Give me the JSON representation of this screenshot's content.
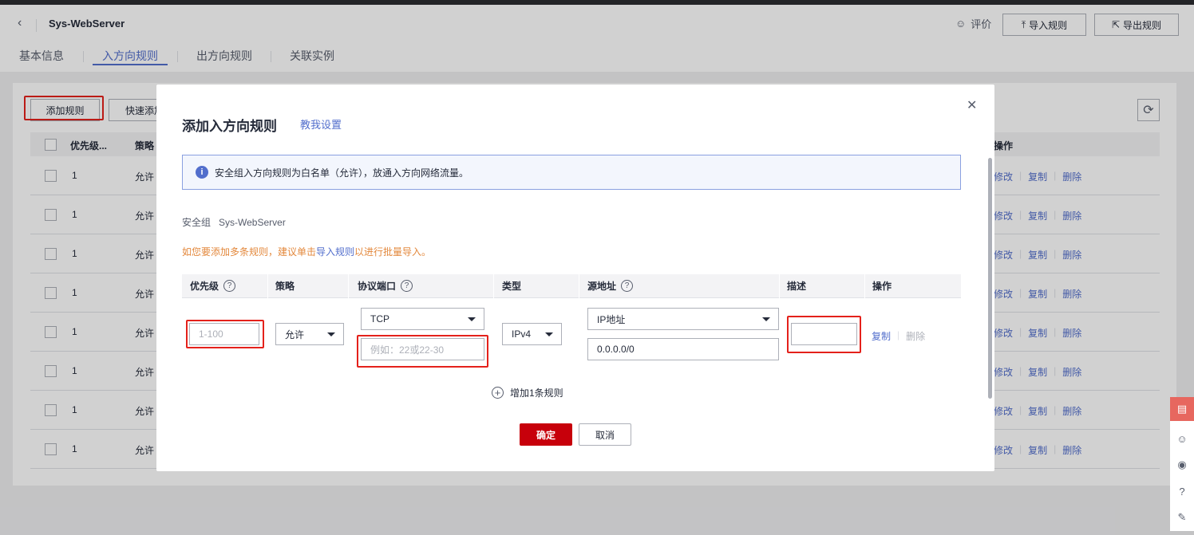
{
  "header": {
    "title": "Sys-WebServer",
    "rate_label": "评价",
    "import_label": "导入规则",
    "export_label": "导出规则"
  },
  "tabs": [
    {
      "label": "基本信息"
    },
    {
      "label": "入方向规则"
    },
    {
      "label": "出方向规则"
    },
    {
      "label": "关联实例"
    }
  ],
  "toolbar": {
    "add_rule": "添加规则",
    "quick_add": "快速添加"
  },
  "table": {
    "headers": {
      "priority": "优先级...",
      "strategy": "策略",
      "ops": "操作"
    },
    "rows": [
      {
        "priority": "1",
        "strategy": "允许"
      },
      {
        "priority": "1",
        "strategy": "允许"
      },
      {
        "priority": "1",
        "strategy": "允许"
      },
      {
        "priority": "1",
        "strategy": "允许"
      },
      {
        "priority": "1",
        "strategy": "允许"
      },
      {
        "priority": "1",
        "strategy": "允许"
      },
      {
        "priority": "1",
        "strategy": "允许"
      },
      {
        "priority": "1",
        "strategy": "允许"
      }
    ],
    "op_edit": "修改",
    "op_copy": "复制",
    "op_delete": "删除"
  },
  "modal": {
    "title": "添加入方向规则",
    "help_link": "教我设置",
    "info": "安全组入方向规则为白名单（允许），放通入方向网络流量。",
    "sg_label": "安全组",
    "sg_name": "Sys-WebServer",
    "warn_pre": "如您要添加多条规则，建议单击",
    "warn_link": "导入规则",
    "warn_post": "以进行批量导入。",
    "columns": {
      "priority": "优先级",
      "strategy": "策略",
      "protocol_port": "协议端口",
      "type": "类型",
      "source": "源地址",
      "description": "描述",
      "operation": "操作"
    },
    "rule": {
      "priority_placeholder": "1-100",
      "strategy_value": "允许",
      "protocol_value": "TCP",
      "port_placeholder": "例如：22或22-30",
      "type_value": "IPv4",
      "source_type": "IP地址",
      "source_value": "0.0.0.0/0",
      "description_value": "",
      "copy": "复制",
      "delete": "删除"
    },
    "add_one": "增加1条规则",
    "confirm": "确定",
    "cancel": "取消"
  },
  "colors": {
    "accent": "#526ecc",
    "primary_button": "#c7000b",
    "highlight_box": "#e4211b",
    "warning_text": "#e3883c"
  }
}
